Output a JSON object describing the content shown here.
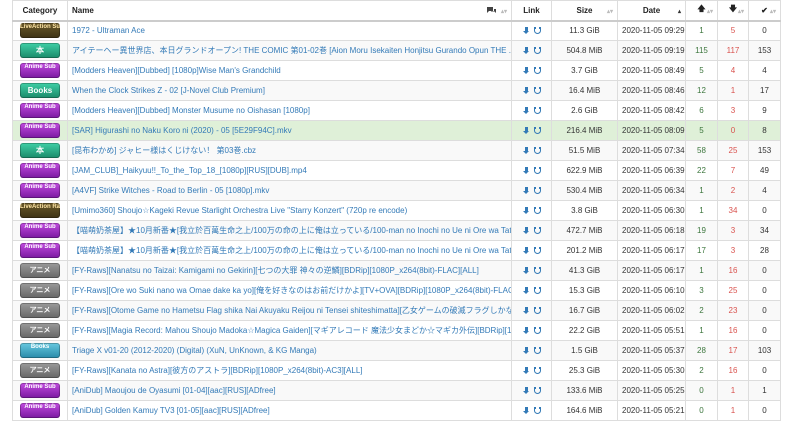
{
  "headers": {
    "category": "Category",
    "name": "Name",
    "link": "Link",
    "size": "Size",
    "date": "Date",
    "seeders_icon": "arrow-up",
    "leechers_icon": "arrow-down",
    "completed_icon": "check",
    "comments_icon": "comments"
  },
  "rows": [
    {
      "cat": "live",
      "cat_label": "LiveAction Sub",
      "name": "1972 - Ultraman Ace",
      "size": "11.3 GiB",
      "date": "2020-11-05 09:29",
      "seeders": "1",
      "leechers": "5",
      "completed": "0",
      "style": ""
    },
    {
      "cat": "lit",
      "cat_label": "本",
      "name": "アイテーヘー異世界店、本日グランドオープン! THE COMIC 第01-02巻 [Aion Moru Isekaiten Honjitsu Gurando Opun THE ...",
      "size": "504.8 MiB",
      "date": "2020-11-05 09:19",
      "seeders": "115",
      "leechers": "117",
      "completed": "153",
      "style": "alt"
    },
    {
      "cat": "anime",
      "cat_label": "Anime Sub",
      "name": "[Modders Heaven][Dubbed] [1080p]Wise Man's Grandchild",
      "size": "3.7 GiB",
      "date": "2020-11-05 08:49",
      "seeders": "5",
      "leechers": "4",
      "completed": "4",
      "style": ""
    },
    {
      "cat": "lit",
      "cat_label": "Books",
      "name": "When the Clock Strikes Z - 02 [J-Novel Club Premium]",
      "size": "16.4 MiB",
      "date": "2020-11-05 08:46",
      "seeders": "12",
      "leechers": "1",
      "completed": "17",
      "style": "alt"
    },
    {
      "cat": "anime",
      "cat_label": "Anime Sub",
      "name": "[Modders Heaven][Dubbed] Monster Musume no Oishasan [1080p]",
      "size": "2.6 GiB",
      "date": "2020-11-05 08:42",
      "seeders": "6",
      "leechers": "3",
      "completed": "9",
      "style": ""
    },
    {
      "cat": "anime",
      "cat_label": "Anime Sub",
      "name": "[SAR] Higurashi no Naku Koro ni (2020) - 05 [5E29F94C].mkv",
      "size": "216.4 MiB",
      "date": "2020-11-05 08:09",
      "seeders": "5",
      "leechers": "0",
      "completed": "8",
      "style": "success"
    },
    {
      "cat": "lit",
      "cat_label": "本",
      "name": "[昆布わかめ] ジャヒー様はくじけない！ 第03巻.cbz",
      "size": "51.5 MiB",
      "date": "2020-11-05 07:34",
      "seeders": "58",
      "leechers": "25",
      "completed": "153",
      "style": "alt"
    },
    {
      "cat": "anime",
      "cat_label": "Anime Sub",
      "name": "[JAM_CLUB]_Haikyuu!!_To_the_Top_18_[1080p][RUS][DUB].mp4",
      "size": "622.9 MiB",
      "date": "2020-11-05 06:39",
      "seeders": "22",
      "leechers": "7",
      "completed": "49",
      "style": ""
    },
    {
      "cat": "anime",
      "cat_label": "Anime Sub",
      "name": "[A4VF] Strike Witches - Road to Berlin - 05 [1080p].mkv",
      "size": "530.4 MiB",
      "date": "2020-11-05 06:34",
      "seeders": "1",
      "leechers": "2",
      "completed": "4",
      "style": "alt"
    },
    {
      "cat": "live",
      "cat_label": "LiveAction Raw",
      "name": "[Umimo360] Shoujo☆Kageki Revue Starlight Orchestra Live \"Starry Konzert\" (720p re encode)",
      "size": "3.8 GiB",
      "date": "2020-11-05 06:30",
      "seeders": "1",
      "leechers": "34",
      "completed": "0",
      "style": ""
    },
    {
      "cat": "anime",
      "cat_label": "Anime Sub",
      "name": "【喵萌奶茶屋】★10月新番★[我立於百萬生命之上/100万の命の上に俺は立っている/100-man no Inochi no Ue ni Ore wa Tatte Ir...",
      "size": "472.7 MiB",
      "date": "2020-11-05 06:18",
      "seeders": "19",
      "leechers": "3",
      "completed": "34",
      "style": "alt"
    },
    {
      "cat": "anime",
      "cat_label": "Anime Sub",
      "name": "【喵萌奶茶屋】★10月新番★[我立於百萬生命之上/100万の命の上に俺は立っている/100-man no Inochi no Ue ni Ore wa Tatte Ir...",
      "size": "201.2 MiB",
      "date": "2020-11-05 06:17",
      "seeders": "17",
      "leechers": "3",
      "completed": "28",
      "style": ""
    },
    {
      "cat": "anime-raw",
      "cat_label": "アニメ",
      "name": "[FY-Raws][Nanatsu no Taizai: Kamigami no Gekirin][七つの大罪 神々の逆鱗][BDRip][1080P_x264(8bit)-FLAC][ALL]",
      "size": "41.3 GiB",
      "date": "2020-11-05 06:17",
      "seeders": "1",
      "leechers": "16",
      "completed": "0",
      "style": "alt"
    },
    {
      "cat": "anime-raw",
      "cat_label": "アニメ",
      "name": "[FY-Raws][Ore wo Suki nano wa Omae dake ka yo][俺を好きなのはお前だけかよ][TV+OVA][BDRip][1080P_x264(8bit)-FLAC][AL...",
      "size": "15.3 GiB",
      "date": "2020-11-05 06:10",
      "seeders": "3",
      "leechers": "25",
      "completed": "0",
      "style": ""
    },
    {
      "cat": "anime-raw",
      "cat_label": "アニメ",
      "name": "[FY-Raws][Otome Game no Hametsu Flag shika Nai Akuyaku Reijou ni Tensei shiteshimatta][乙女ゲームの破滅フラグしかない...",
      "size": "16.7 GiB",
      "date": "2020-11-05 06:02",
      "seeders": "2",
      "leechers": "23",
      "completed": "0",
      "style": "alt"
    },
    {
      "cat": "anime-raw",
      "cat_label": "アニメ",
      "name": "[FY-Raws][Magia Record: Mahou Shoujo Madoka☆Magica Gaiden][マギアレコード 魔法少女まどか☆マギカ外伝][BDRip][1080P_x264...",
      "size": "22.2 GiB",
      "date": "2020-11-05 05:51",
      "seeders": "1",
      "leechers": "16",
      "completed": "0",
      "style": ""
    },
    {
      "cat": "nonen",
      "cat_label": "Books",
      "name": "Triage X v01-20 (2012-2020) (Digital) (XuN, UnKnown, & KG Manga)",
      "size": "1.5 GiB",
      "date": "2020-11-05 05:37",
      "seeders": "28",
      "leechers": "17",
      "completed": "103",
      "style": "alt"
    },
    {
      "cat": "anime-raw",
      "cat_label": "アニメ",
      "name": "[FY-Raws][Kanata no Astra][彼方のアストラ][BDRip][1080P_x264(8bit)-AC3][ALL]",
      "size": "25.3 GiB",
      "date": "2020-11-05 05:30",
      "seeders": "2",
      "leechers": "16",
      "completed": "0",
      "style": ""
    },
    {
      "cat": "anime",
      "cat_label": "Anime Sub",
      "name": "[AniDub] Maoujou de Oyasumi [01-04][aac][RUS][ADfree]",
      "size": "133.6 MiB",
      "date": "2020-11-05 05:25",
      "seeders": "0",
      "leechers": "1",
      "completed": "1",
      "style": "alt"
    },
    {
      "cat": "anime",
      "cat_label": "Anime Sub",
      "name": "[AniDub] Golden Kamuy TV3 [01-05][aac][RUS][ADfree]",
      "size": "164.6 MiB",
      "date": "2020-11-05 05:21",
      "seeders": "0",
      "leechers": "1",
      "completed": "0",
      "style": ""
    }
  ]
}
